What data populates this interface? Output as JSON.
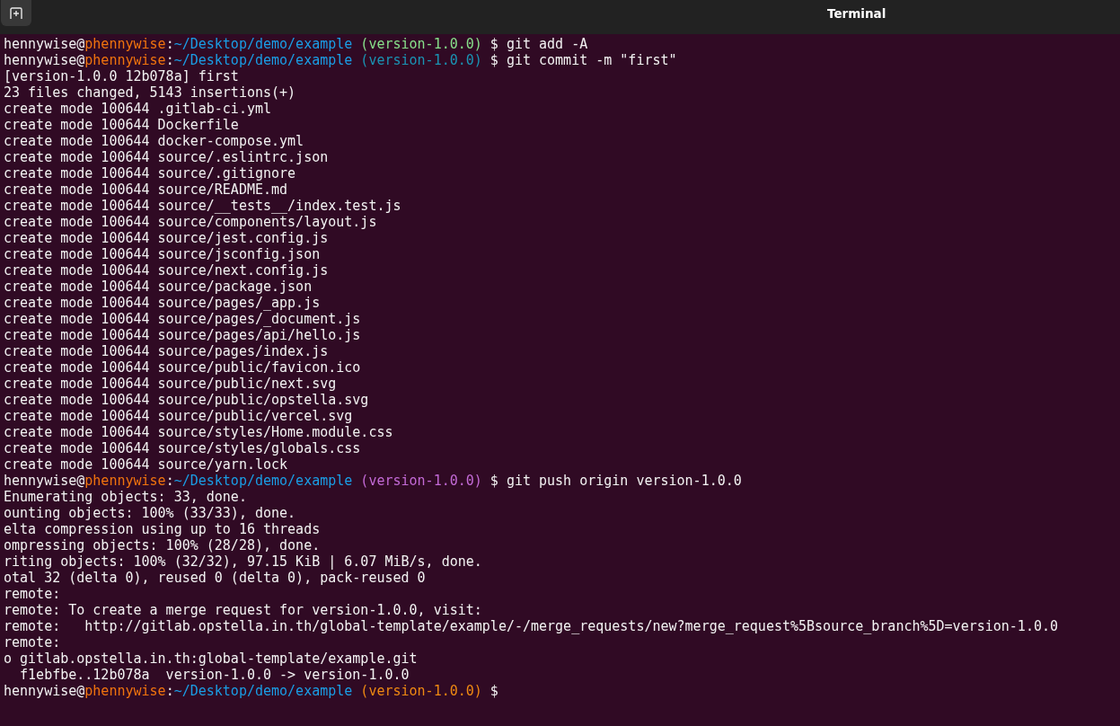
{
  "window": {
    "title": "Terminal"
  },
  "terminal": {
    "lines": [
      {
        "kind": "prompt",
        "user": "hennywise",
        "at": "@",
        "host": "phennywise",
        "colon": ":",
        "path": "~/Desktop/demo/example",
        "branch": {
          "text": "(version-1.0.0)",
          "color": "#87e08a"
        },
        "symbol": "$",
        "command": "git add -A"
      },
      {
        "kind": "prompt",
        "user": "hennywise",
        "at": "@",
        "host": "phennywise",
        "colon": ":",
        "path": "~/Desktop/demo/example",
        "branch": {
          "text": "(version-1.0.0)",
          "color": "#1a94b4"
        },
        "symbol": "$",
        "command": "git commit -m \"first\""
      },
      {
        "kind": "output",
        "text": "[version-1.0.0 12b078a] first"
      },
      {
        "kind": "output",
        "text": "23 files changed, 5143 insertions(+)"
      },
      {
        "kind": "output",
        "text": "create mode 100644 .gitlab-ci.yml"
      },
      {
        "kind": "output",
        "text": "create mode 100644 Dockerfile"
      },
      {
        "kind": "output",
        "text": "create mode 100644 docker-compose.yml"
      },
      {
        "kind": "output",
        "text": "create mode 100644 source/.eslintrc.json"
      },
      {
        "kind": "output",
        "text": "create mode 100644 source/.gitignore"
      },
      {
        "kind": "output",
        "text": "create mode 100644 source/README.md"
      },
      {
        "kind": "output",
        "text": "create mode 100644 source/__tests__/index.test.js"
      },
      {
        "kind": "output",
        "text": "create mode 100644 source/components/layout.js"
      },
      {
        "kind": "output",
        "text": "create mode 100644 source/jest.config.js"
      },
      {
        "kind": "output",
        "text": "create mode 100644 source/jsconfig.json"
      },
      {
        "kind": "output",
        "text": "create mode 100644 source/next.config.js"
      },
      {
        "kind": "output",
        "text": "create mode 100644 source/package.json"
      },
      {
        "kind": "output",
        "text": "create mode 100644 source/pages/_app.js"
      },
      {
        "kind": "output",
        "text": "create mode 100644 source/pages/_document.js"
      },
      {
        "kind": "output",
        "text": "create mode 100644 source/pages/api/hello.js"
      },
      {
        "kind": "output",
        "text": "create mode 100644 source/pages/index.js"
      },
      {
        "kind": "output",
        "text": "create mode 100644 source/public/favicon.ico"
      },
      {
        "kind": "output",
        "text": "create mode 100644 source/public/next.svg"
      },
      {
        "kind": "output",
        "text": "create mode 100644 source/public/opstella.svg"
      },
      {
        "kind": "output",
        "text": "create mode 100644 source/public/vercel.svg"
      },
      {
        "kind": "output",
        "text": "create mode 100644 source/styles/Home.module.css"
      },
      {
        "kind": "output",
        "text": "create mode 100644 source/styles/globals.css"
      },
      {
        "kind": "output",
        "text": "create mode 100644 source/yarn.lock"
      },
      {
        "kind": "prompt",
        "user": "hennywise",
        "at": "@",
        "host": "phennywise",
        "colon": ":",
        "path": "~/Desktop/demo/example",
        "branch": {
          "text": "(version-1.0.0)",
          "color": "#c36ad6"
        },
        "symbol": "$",
        "command": "git push origin version-1.0.0"
      },
      {
        "kind": "output",
        "text": "Enumerating objects: 33, done."
      },
      {
        "kind": "output",
        "text": "ounting objects: 100% (33/33), done."
      },
      {
        "kind": "output",
        "text": "elta compression using up to 16 threads"
      },
      {
        "kind": "output",
        "text": "ompressing objects: 100% (28/28), done."
      },
      {
        "kind": "output",
        "text": "riting objects: 100% (32/32), 97.15 KiB | 6.07 MiB/s, done."
      },
      {
        "kind": "output",
        "text": "otal 32 (delta 0), reused 0 (delta 0), pack-reused 0"
      },
      {
        "kind": "output",
        "text": "remote:"
      },
      {
        "kind": "output",
        "text": "remote: To create a merge request for version-1.0.0, visit:"
      },
      {
        "kind": "output",
        "text": "remote:   http://gitlab.opstella.in.th/global-template/example/-/merge_requests/new?merge_request%5Bsource_branch%5D=version-1.0.0"
      },
      {
        "kind": "output",
        "text": "remote:"
      },
      {
        "kind": "output",
        "text": "o gitlab.opstella.in.th:global-template/example.git"
      },
      {
        "kind": "output",
        "text": "  f1ebfbe..12b078a  version-1.0.0 -> version-1.0.0"
      },
      {
        "kind": "prompt",
        "user": "hennywise",
        "at": "@",
        "host": "phennywise",
        "colon": ":",
        "path": "~/Desktop/demo/example",
        "branch": {
          "text": "(version-1.0.0)",
          "color": "#ef8912"
        },
        "symbol": "$"
      }
    ]
  }
}
